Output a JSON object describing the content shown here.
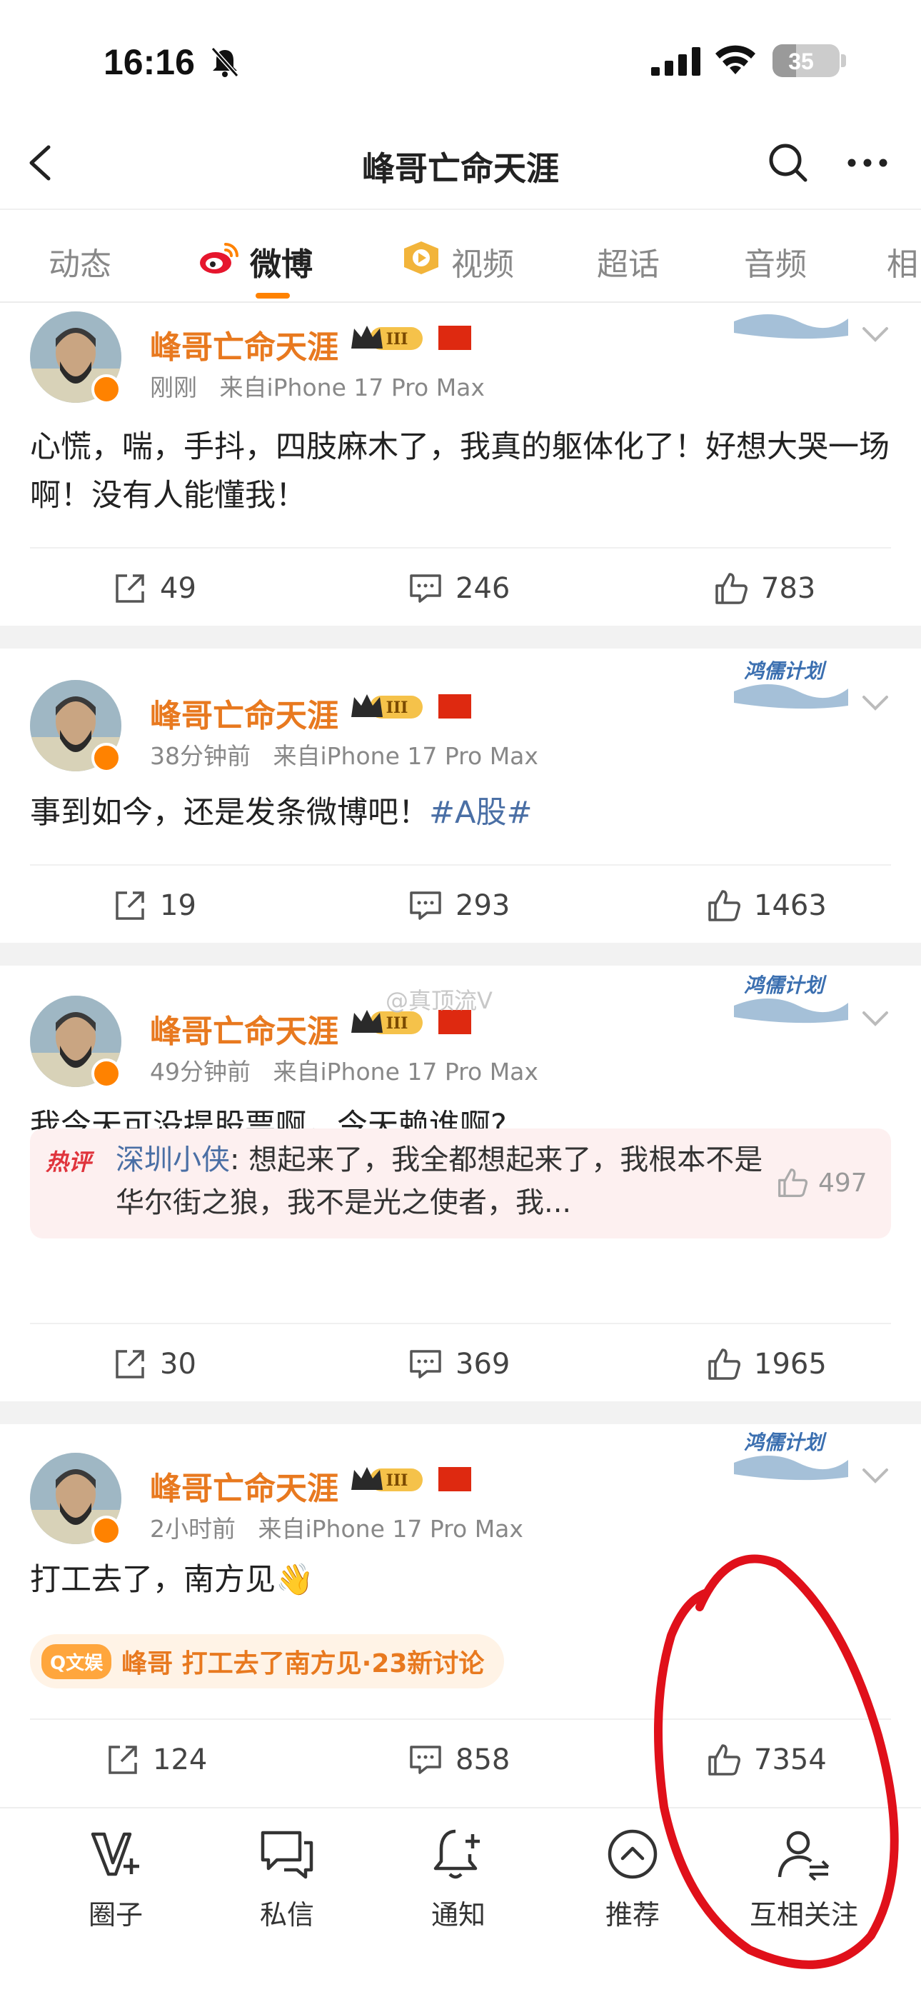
{
  "status_bar": {
    "time": "16:16",
    "battery": "35",
    "battery_level": 0.35
  },
  "header": {
    "title": "峰哥亡命天涯"
  },
  "tabs": [
    {
      "label": "动态"
    },
    {
      "label": "微博"
    },
    {
      "label": "视频"
    },
    {
      "label": "超话"
    },
    {
      "label": "音频"
    },
    {
      "label": "相"
    }
  ],
  "posts": [
    {
      "author": "峰哥亡命天涯",
      "level": "III",
      "time": "刚刚",
      "source": "来自iPhone 17 Pro Max",
      "text": "心慌，喘，手抖，四肢麻木了，我真的躯体化了！好想大哭一场啊！没有人能懂我！",
      "reposts": "49",
      "comments": "246",
      "likes": "783"
    },
    {
      "author": "峰哥亡命天涯",
      "level": "III",
      "time": "38分钟前",
      "source": "来自iPhone 17 Pro Max",
      "text": "事到如今，还是发条微博吧！",
      "hashtag": "#A股#",
      "sticker": "鸿儒计划",
      "reposts": "19",
      "comments": "293",
      "likes": "1463"
    },
    {
      "author": "峰哥亡命天涯",
      "level": "III",
      "time": "49分钟前",
      "source": "来自iPhone 17 Pro Max",
      "text": "我今天可没提股票啊，今天赖谁啊?",
      "sticker": "鸿儒计划",
      "hot_comment": {
        "label": "热评",
        "user": "深圳小侠",
        "text": ": 想起来了，我全都想起来了，我根本不是华尔街之狼，我不是光之使者，我...",
        "likes": "497"
      },
      "reposts": "30",
      "comments": "369",
      "likes": "1965"
    },
    {
      "author": "峰哥亡命天涯",
      "level": "III",
      "time": "2小时前",
      "source": "来自iPhone 17 Pro Max",
      "text": "打工去了，南方见👋",
      "sticker": "鸿儒计划",
      "topic": {
        "chip": "Q文娱",
        "text": "峰哥 打工去了南方见·23新讨论"
      },
      "reposts": "124",
      "comments": "858",
      "likes": "7354"
    }
  ],
  "watermark": "@真顶流V",
  "bottom_bar": [
    {
      "label": "圈子",
      "icon": "circle-v-icon"
    },
    {
      "label": "私信",
      "icon": "message-icon"
    },
    {
      "label": "通知",
      "icon": "bell-plus-icon"
    },
    {
      "label": "推荐",
      "icon": "chevron-up-circle-icon"
    },
    {
      "label": "互相关注",
      "icon": "mutual-follow-icon"
    }
  ],
  "colors": {
    "accent": "#ff8200",
    "author": "#e8791f",
    "link": "#4a6fa5",
    "annotation": "#e0101a"
  }
}
